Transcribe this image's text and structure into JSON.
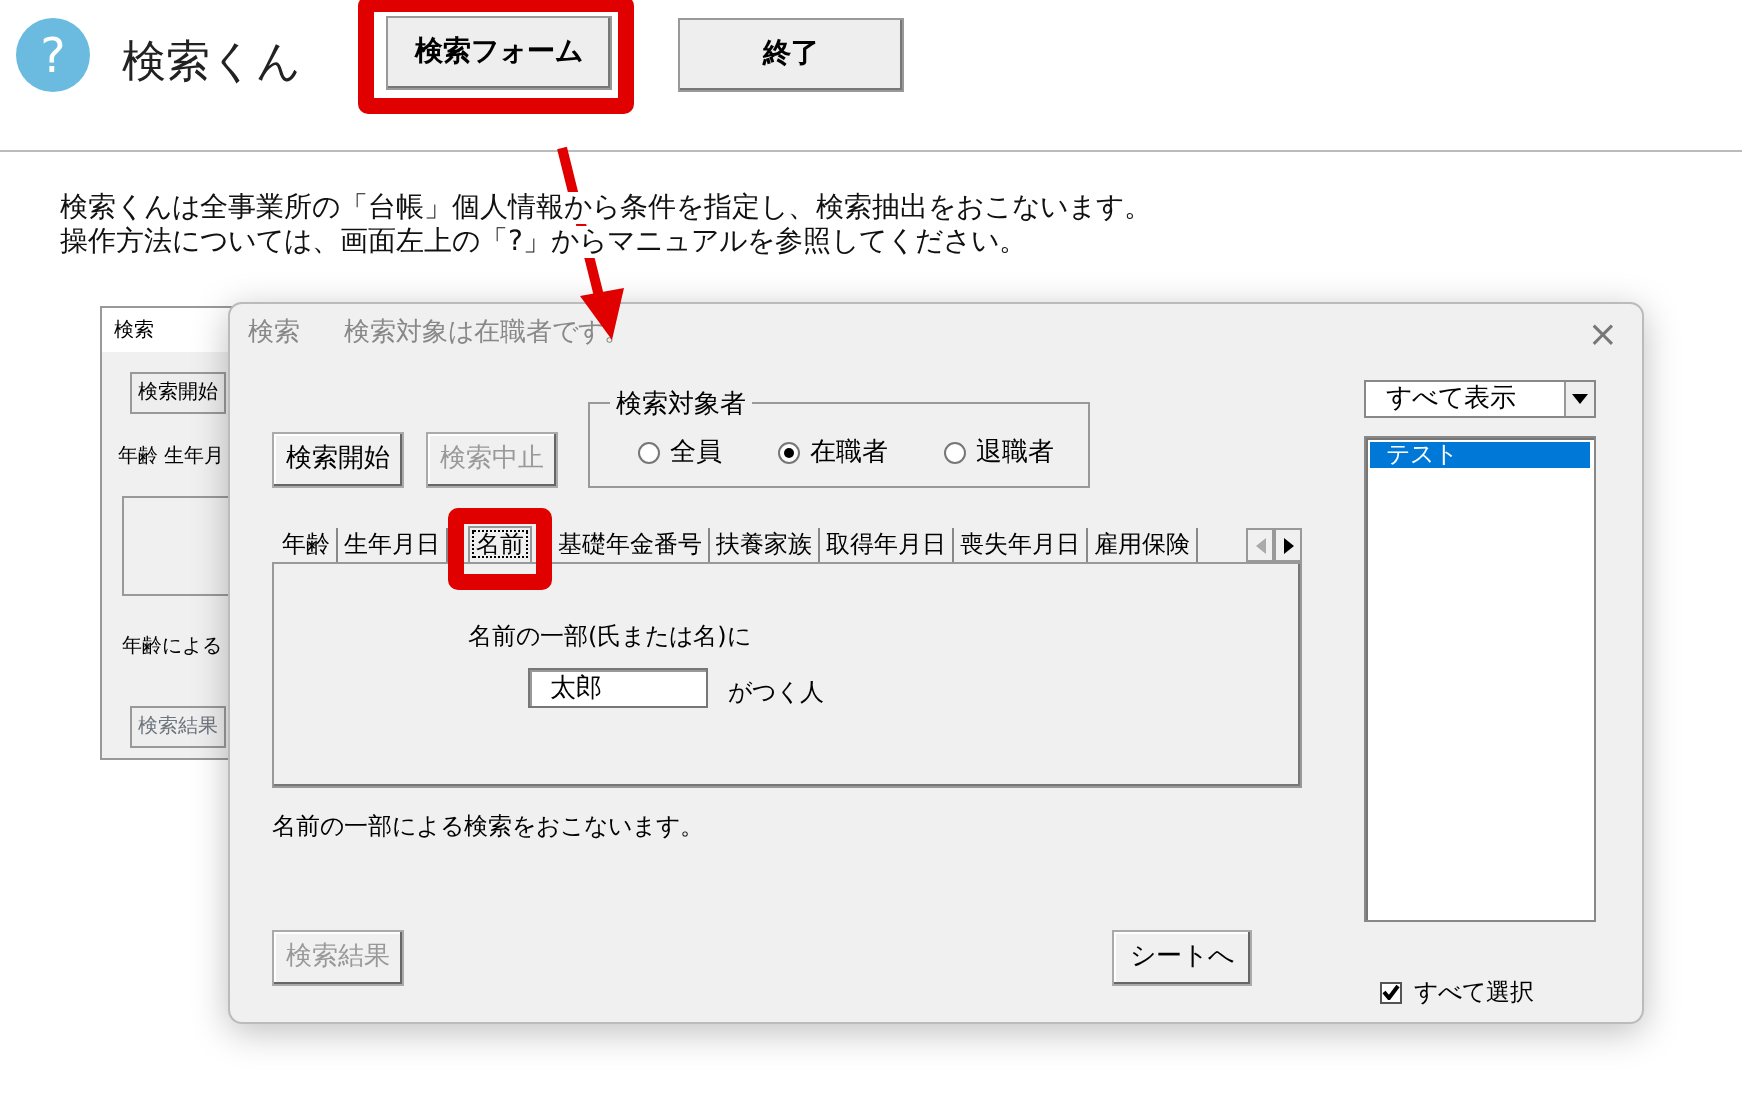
{
  "app": {
    "help_icon": "?",
    "title": "検索くん",
    "buttons": [
      {
        "label": "検索フォーム",
        "highlighted": true
      },
      {
        "label": "終了",
        "highlighted": false
      }
    ]
  },
  "intro": [
    "検索くんは全事業所の「台帳」個人情報から条件を指定し、検索抽出をおこないます。",
    "操作方法については、画面左上の「?」からマニュアルを参照してください。"
  ],
  "back_window": {
    "title": "検索",
    "start_button": "検索開始",
    "tabs": [
      "年齢",
      "生年月"
    ],
    "status": "年齢による",
    "result_button": "検索結果"
  },
  "dialog": {
    "title": "検索",
    "subtitle": "検索対象は在職者です。",
    "close": "×",
    "buttons": [
      {
        "label": "検索開始",
        "disabled": false
      },
      {
        "label": "検索中止",
        "disabled": true
      }
    ],
    "target_group": {
      "legend": "検索対象者",
      "options": [
        {
          "label": "全員",
          "selected": false
        },
        {
          "label": "在職者",
          "selected": true
        },
        {
          "label": "退職者",
          "selected": false
        }
      ]
    },
    "tabs": [
      {
        "label": "年齢",
        "selected": false,
        "highlighted": false
      },
      {
        "label": "生年月日",
        "selected": false,
        "highlighted": false
      },
      {
        "label": "名前",
        "selected": true,
        "highlighted": true
      },
      {
        "label": "基礎年金番号",
        "selected": false,
        "highlighted": false
      },
      {
        "label": "扶養家族",
        "selected": false,
        "highlighted": false
      },
      {
        "label": "取得年月日",
        "selected": false,
        "highlighted": false
      },
      {
        "label": "喪失年月日",
        "selected": false,
        "highlighted": false
      },
      {
        "label": "雇用保険",
        "selected": false,
        "highlighted": false
      }
    ],
    "panel": {
      "prompt": "名前の一部(氏または名)に",
      "value": "太郎",
      "suffix": "がつく人"
    },
    "status": "名前の一部による検索をおこないます。",
    "result_button": {
      "label": "検索結果",
      "disabled": true
    },
    "sheet_button": {
      "label": "シートへ",
      "disabled": false
    },
    "filter": {
      "value": "すべて表示"
    },
    "list": [
      {
        "label": "テスト",
        "selected": true
      }
    ],
    "select_all": {
      "label": "すべて選択",
      "checked": true
    }
  }
}
